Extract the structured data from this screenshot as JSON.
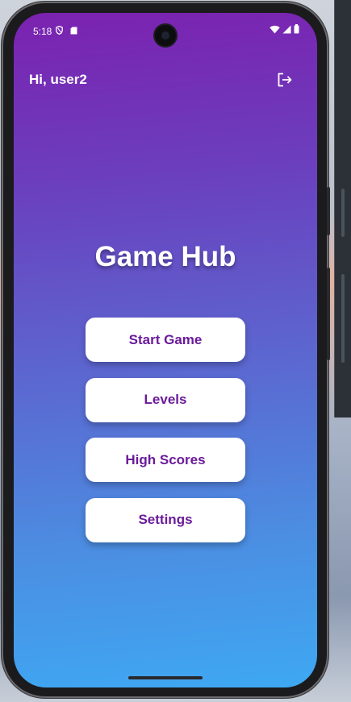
{
  "status_bar": {
    "time": "5:18",
    "icons": [
      "shield-icon",
      "sd-card-icon",
      "wifi-icon",
      "signal-icon",
      "battery-icon"
    ]
  },
  "header": {
    "greeting": "Hi, user2",
    "logout_icon": "logout-icon"
  },
  "main": {
    "title": "Game Hub",
    "buttons": [
      {
        "label": "Start Game"
      },
      {
        "label": "Levels"
      },
      {
        "label": "High Scores"
      },
      {
        "label": "Settings"
      }
    ]
  },
  "colors": {
    "gradient_top": "#7b22b0",
    "gradient_bottom": "#3ea8f3",
    "button_text": "#6a1b9a",
    "button_bg": "#ffffff"
  }
}
